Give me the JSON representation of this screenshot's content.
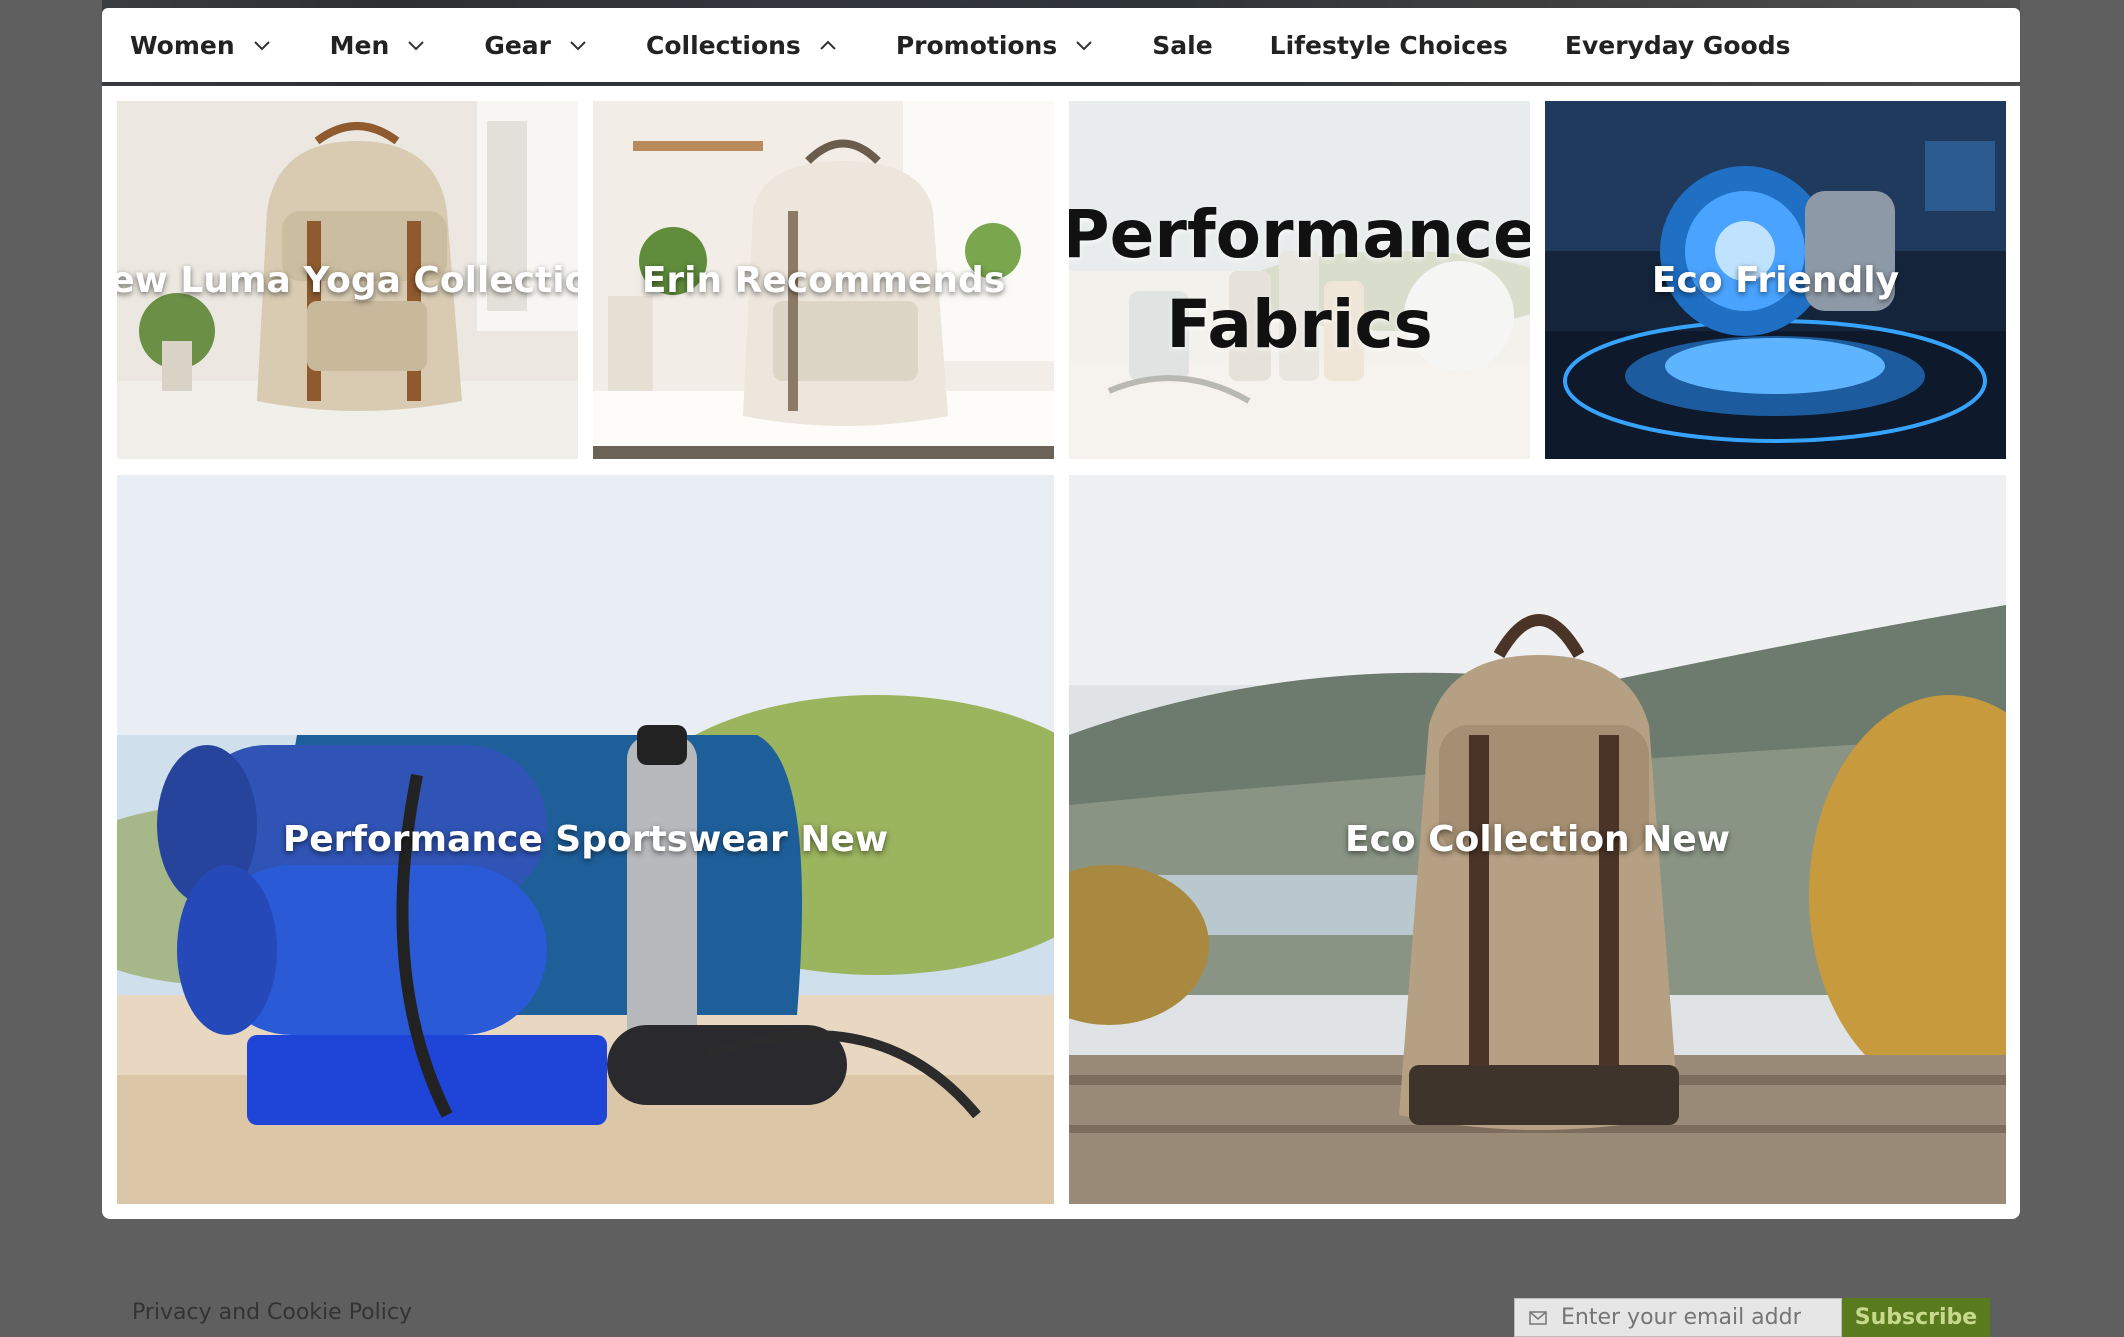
{
  "nav": {
    "items": [
      {
        "label": "Women",
        "chevron": "down"
      },
      {
        "label": "Men",
        "chevron": "down"
      },
      {
        "label": "Gear",
        "chevron": "down"
      },
      {
        "label": "Collections",
        "chevron": "up"
      },
      {
        "label": "Promotions",
        "chevron": "down"
      },
      {
        "label": "Sale"
      },
      {
        "label": "Lifestyle Choices"
      },
      {
        "label": "Everyday Goods"
      }
    ]
  },
  "menu": {
    "tiles": [
      {
        "label": "New Luma Yoga Collection",
        "image": "backpack-beige"
      },
      {
        "label": "Erin Recommends",
        "image": "backpack-cream"
      },
      {
        "label": "Performance Fabrics",
        "image": "bottles-light"
      },
      {
        "label": "Eco Friendly",
        "image": "blue-tech-turbine"
      },
      {
        "label": "Performance Sportswear New",
        "image": "yoga-mats-duffel"
      },
      {
        "label": "Eco Collection New",
        "image": "canvas-backpack-outdoor"
      }
    ]
  },
  "footer": {
    "privacy_link": "Privacy and Cookie Policy",
    "email_placeholder": "Enter your email address",
    "subscribe_label": "Subscribe"
  },
  "colors": {
    "subscribe_bg": "#5a7a1e",
    "nav_text": "#222222"
  }
}
